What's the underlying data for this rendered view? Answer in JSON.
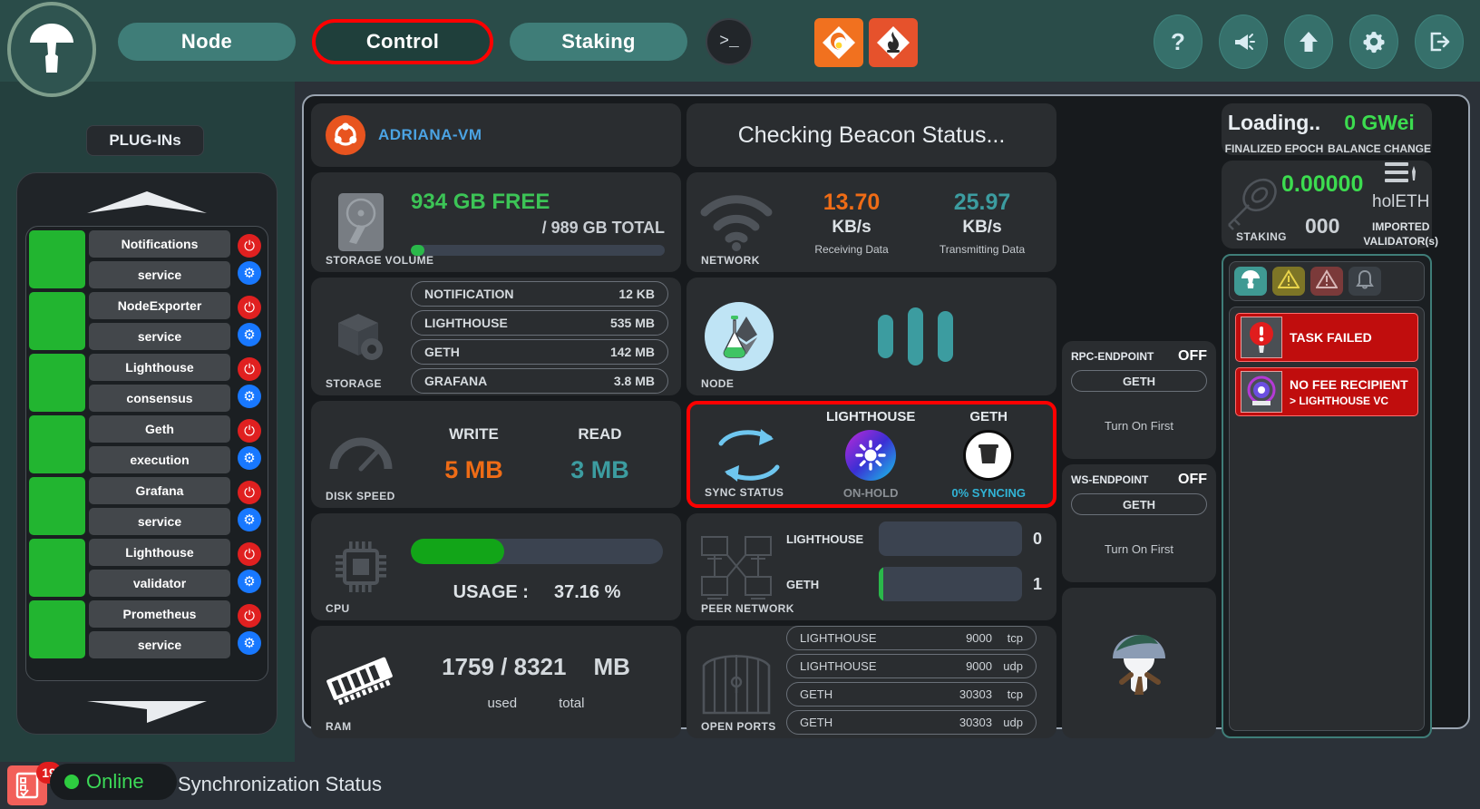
{
  "header": {
    "logo_icon": "mushroom-logo",
    "tabs": [
      {
        "label": "Node",
        "active": false
      },
      {
        "label": "Control",
        "active": true
      },
      {
        "label": "Staking",
        "active": false
      }
    ],
    "terminal_icon": "terminal-icon",
    "grafana_icon": "grafana-icon",
    "prometheus_icon": "prometheus-icon",
    "right_buttons": [
      {
        "name": "help-button",
        "glyph": "?"
      },
      {
        "name": "announce-button",
        "glyph": "megaphone-icon"
      },
      {
        "name": "update-button",
        "glyph": "arrow-up-icon"
      },
      {
        "name": "settings-button",
        "glyph": "gear-icon"
      },
      {
        "name": "logout-button",
        "glyph": "logout-icon"
      }
    ]
  },
  "sidebar": {
    "title": "PLUG-INs",
    "scroll_up_icon": "chevron-up-icon",
    "scroll_down_icon": "chevron-down-icon",
    "plugins": [
      {
        "name": "Notifications",
        "kind": "service",
        "status_color": "#22b530"
      },
      {
        "name": "NodeExporter",
        "kind": "service",
        "status_color": "#22b530"
      },
      {
        "name": "Lighthouse",
        "kind": "consensus",
        "status_color": "#22b530"
      },
      {
        "name": "Geth",
        "kind": "execution",
        "status_color": "#22b530"
      },
      {
        "name": "Grafana",
        "kind": "service",
        "status_color": "#22b530"
      },
      {
        "name": "Lighthouse",
        "kind": "validator",
        "status_color": "#22b530"
      },
      {
        "name": "Prometheus",
        "kind": "service",
        "status_color": "#22b530"
      }
    ]
  },
  "statusbar": {
    "notif_count": "19",
    "online_label": "Online",
    "sync_label": "Synchronization Status"
  },
  "main": {
    "host": {
      "label": "STORAGE VOLUME",
      "hostname": "ADRIANA-VM",
      "os_icon": "ubuntu-icon"
    },
    "storage_volume": {
      "label": "STORAGE VOLUME",
      "free": "934 GB FREE",
      "total": "/ 989 GB TOTAL",
      "fill_percent": 5.5
    },
    "storage": {
      "label": "STORAGE",
      "rows": [
        {
          "name": "NOTIFICATION",
          "size": "12 KB"
        },
        {
          "name": "LIGHTHOUSE",
          "size": "535 MB"
        },
        {
          "name": "GETH",
          "size": "142 MB"
        },
        {
          "name": "GRAFANA",
          "size": "3.8 MB"
        }
      ]
    },
    "disk_speed": {
      "label": "DISK SPEED",
      "write_head": "WRITE",
      "write_value": "5 MB",
      "read_head": "READ",
      "read_value": "3 MB"
    },
    "cpu": {
      "label": "CPU",
      "usage_head": "USAGE :",
      "usage_value": "37.16 %",
      "fill_percent": 37.16
    },
    "ram": {
      "label": "RAM",
      "value": "1759 / 8321",
      "unit": "MB",
      "used_cap": "used",
      "total_cap": "total"
    },
    "beacon": {
      "status": "Checking Beacon Status..."
    },
    "network": {
      "label": "NETWORK",
      "rx_value": "13.70",
      "rx_unit": "KB/s",
      "rx_cap": "Receiving Data",
      "tx_value": "25.97",
      "tx_unit": "KB/s",
      "tx_cap": "Transmitting Data"
    },
    "node": {
      "label": "NODE",
      "icon": "ethereum-testnet-icon",
      "bars": [
        60,
        80,
        70
      ]
    },
    "sync_status": {
      "label": "SYNC STATUS",
      "icon": "sync-arrows-icon",
      "highlighted": true,
      "items": [
        {
          "head": "LIGHTHOUSE",
          "state": "ON-HOLD",
          "state_color": "#8a8f94",
          "icon": "lighthouse-icon"
        },
        {
          "head": "GETH",
          "state": "0% SYNCING",
          "state_color": "#31b4d6",
          "icon": "geth-icon"
        }
      ]
    },
    "peer_network": {
      "label": "PEER NETWORK",
      "rows": [
        {
          "name": "LIGHTHOUSE",
          "count": "0",
          "fill_percent": 0
        },
        {
          "name": "GETH",
          "count": "1",
          "fill_percent": 3
        }
      ]
    },
    "open_ports": {
      "label": "OPEN PORTS",
      "rows": [
        {
          "name": "LIGHTHOUSE",
          "port": "9000",
          "proto": "tcp"
        },
        {
          "name": "LIGHTHOUSE",
          "port": "9000",
          "proto": "udp"
        },
        {
          "name": "GETH",
          "port": "30303",
          "proto": "tcp"
        },
        {
          "name": "GETH",
          "port": "30303",
          "proto": "udp"
        }
      ]
    },
    "epoch": {
      "finalized_value": "Loading..",
      "finalized_cap": "FINALIZED EPOCH",
      "balance_value": "0 GWei",
      "balance_cap": "BALANCE CHANGE"
    },
    "staking": {
      "label": "STAKING",
      "balance": "0.00000",
      "count": "000",
      "currency": "holETH",
      "currency_icon": "holesky-icon",
      "imported_cap": "IMPORTED\nVALIDATOR(s)",
      "imported_line1": "IMPORTED",
      "imported_line2": "VALIDATOR(s)"
    },
    "rpc_endpoint": {
      "title": "RPC-ENDPOINT",
      "state": "OFF",
      "client": "GETH",
      "note": "Turn On First"
    },
    "ws_endpoint": {
      "title": "WS-ENDPOINT",
      "state": "OFF",
      "client": "GETH",
      "note": "Turn On First"
    },
    "mushroom_card": {
      "icon": "mushroom-illustration"
    }
  },
  "notifications": {
    "tabs": [
      {
        "name": "mushroom-tab",
        "icon": "mushroom-icon",
        "bg": "#3f9a93"
      },
      {
        "name": "warning-tab",
        "icon": "warning-icon",
        "bg": "#7d7526"
      },
      {
        "name": "error-tab",
        "icon": "alert-icon",
        "bg": "#7b3a3a"
      },
      {
        "name": "bell-tab",
        "icon": "bell-icon",
        "bg": "#3a4046"
      }
    ],
    "alerts": [
      {
        "title": "TASK FAILED",
        "sub": "",
        "icon": "exclamation-icon"
      },
      {
        "title": "NO FEE RECIPIENT",
        "sub": "> LIGHTHOUSE VC",
        "icon": "validator-icon"
      }
    ]
  },
  "colors": {
    "header_bg": "#2a4c49",
    "tab_bg": "#3f7d78",
    "highlight_red": "#ff0000",
    "green": "#3cdc4f",
    "orange": "#ef6c16",
    "teal": "#3c9ca0"
  }
}
